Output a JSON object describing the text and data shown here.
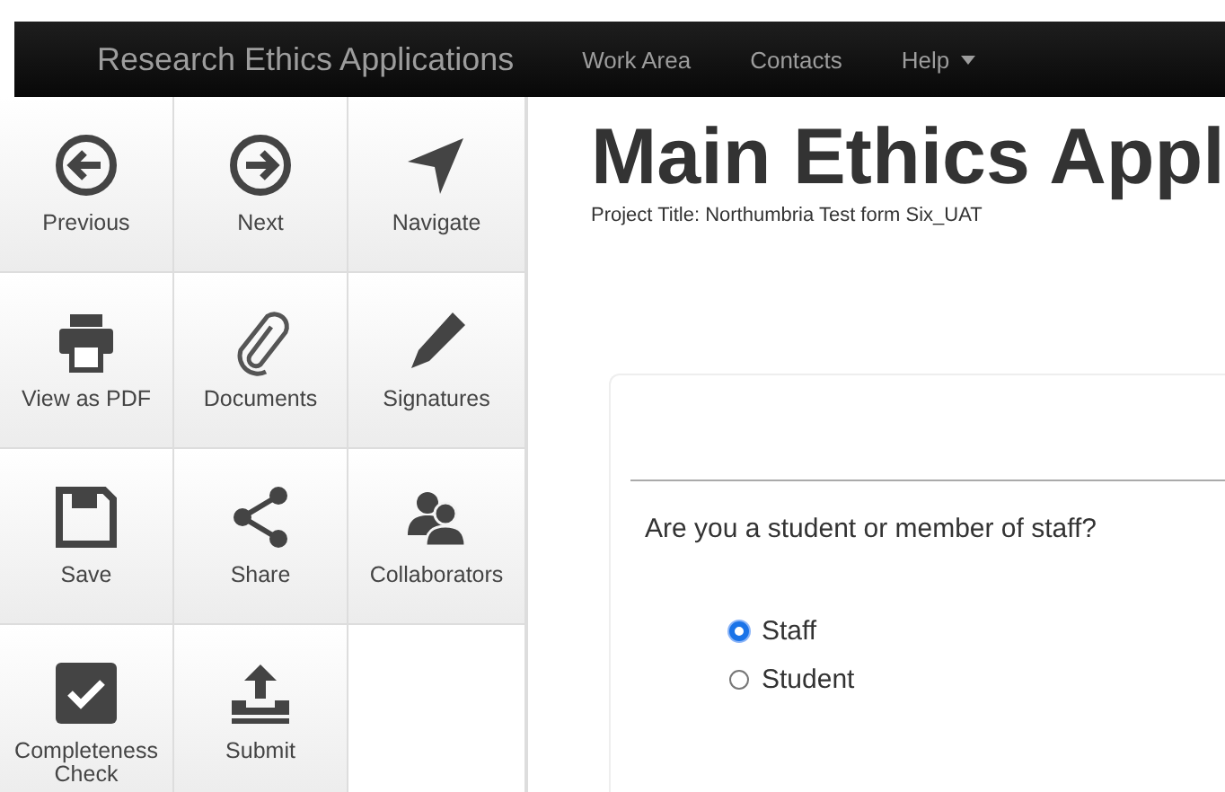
{
  "navbar": {
    "brand": "Research Ethics Applications",
    "links": [
      {
        "label": "Work Area",
        "has_menu": false
      },
      {
        "label": "Contacts",
        "has_menu": false
      },
      {
        "label": "Help",
        "has_menu": true
      }
    ]
  },
  "toolbar": [
    {
      "label": "Previous"
    },
    {
      "label": "Next"
    },
    {
      "label": "Navigate"
    },
    {
      "label": "View as PDF"
    },
    {
      "label": "Documents"
    },
    {
      "label": "Signatures"
    },
    {
      "label": "Save"
    },
    {
      "label": "Share"
    },
    {
      "label": "Collaborators"
    },
    {
      "label": "Completeness Check"
    },
    {
      "label": "Submit"
    }
  ],
  "page": {
    "title": "Main Ethics Appl",
    "project_title": "Project Title: Northumbria Test form Six_UAT"
  },
  "question": {
    "text": "Are you a student or member of staff?",
    "options": [
      {
        "label": "Staff",
        "selected": true
      },
      {
        "label": "Student",
        "selected": false
      }
    ]
  }
}
